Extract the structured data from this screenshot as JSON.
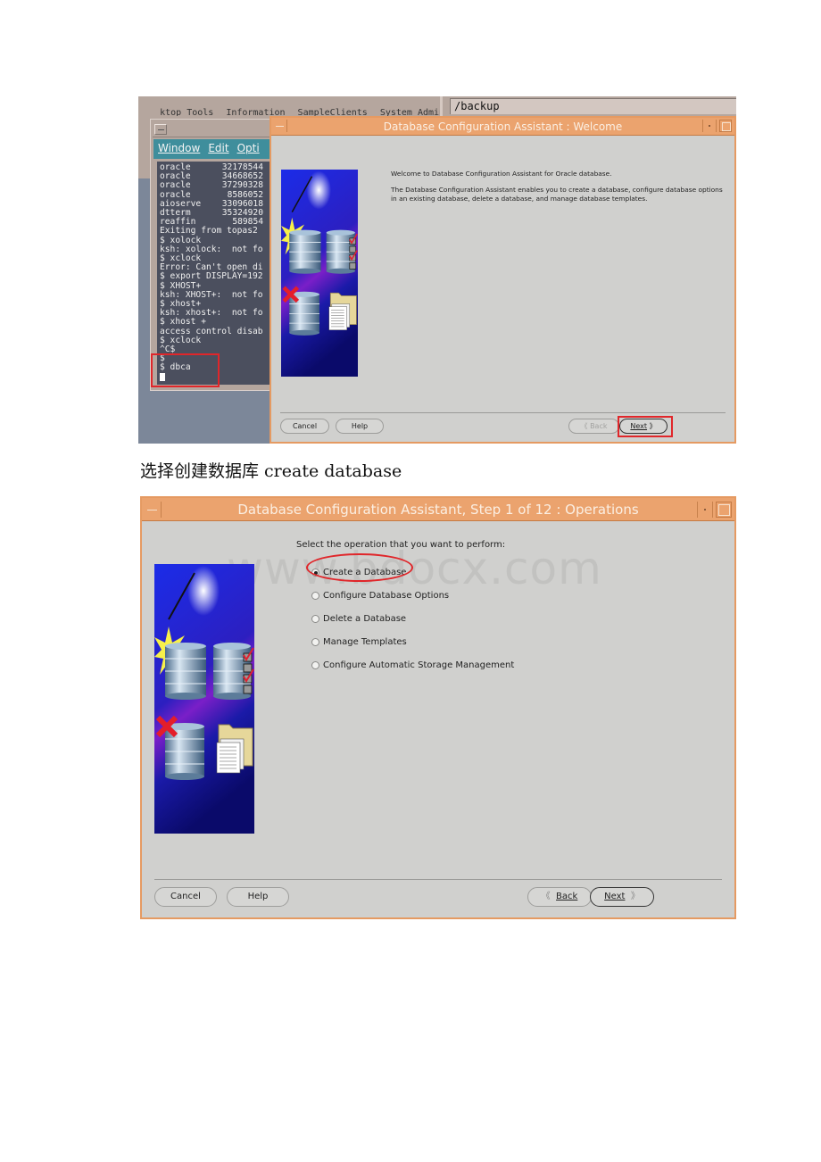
{
  "screenshot1": {
    "desktop_menu": [
      "ktop_Tools",
      "Information",
      "SampleClients",
      "System_Admin"
    ],
    "path_field": "/backup",
    "terminal": {
      "menu": [
        "Window",
        "Edit",
        "Opti"
      ],
      "processes": [
        {
          "name": "oracle",
          "value": "32178544"
        },
        {
          "name": "oracle",
          "value": "34668652"
        },
        {
          "name": "oracle",
          "value": "37290328"
        },
        {
          "name": "oracle",
          "value": "8586052"
        },
        {
          "name": "aioserve",
          "value": "33096018"
        },
        {
          "name": "dtterm",
          "value": "35324920"
        },
        {
          "name": "reaffin",
          "value": "589854"
        }
      ],
      "lines": [
        "Exiting from topas2",
        "$ xolock",
        "ksh: xolock:  not fo",
        "$ xclock",
        "Error: Can't open di",
        "$ export DISPLAY=192",
        "$ XHOST+",
        "ksh: XHOST+:  not fo",
        "$ xhost+",
        "ksh: xhost+:  not fo",
        "$ xhost +",
        "access control disab",
        "$ xclock",
        "^C$",
        "$",
        "$ dbca"
      ]
    },
    "welcome_window": {
      "title": "Database Configuration Assistant : Welcome",
      "intro": "Welcome to Database Configuration Assistant for Oracle database.",
      "description": "The Database Configuration Assistant enables you to create a database, configure database options in an existing database, delete a database, and manage database templates.",
      "buttons": {
        "cancel": "Cancel",
        "help": "Help",
        "back": "Back",
        "next": "Next"
      },
      "back_enabled": false
    }
  },
  "caption": "选择创建数据库 create database",
  "screenshot2": {
    "title": "Database Configuration Assistant, Step 1 of 12 : Operations",
    "prompt": "Select the operation that you want to perform:",
    "watermark": "www.bdocx.com",
    "options": [
      {
        "label": "Create a Database",
        "selected": true
      },
      {
        "label": "Configure Database Options",
        "selected": false
      },
      {
        "label": "Delete a Database",
        "selected": false
      },
      {
        "label": "Manage Templates",
        "selected": false
      },
      {
        "label": "Configure Automatic Storage Management",
        "selected": false
      }
    ],
    "buttons": {
      "cancel": "Cancel",
      "help": "Help",
      "back": "Back",
      "next": "Next"
    }
  },
  "colors": {
    "title_bar": "#eba36e",
    "terminal_menu": "#3f8e9c",
    "terminal_bg": "#4b4f5e",
    "highlight": "#e0262a",
    "dialog_bg": "#d0d0ce"
  }
}
